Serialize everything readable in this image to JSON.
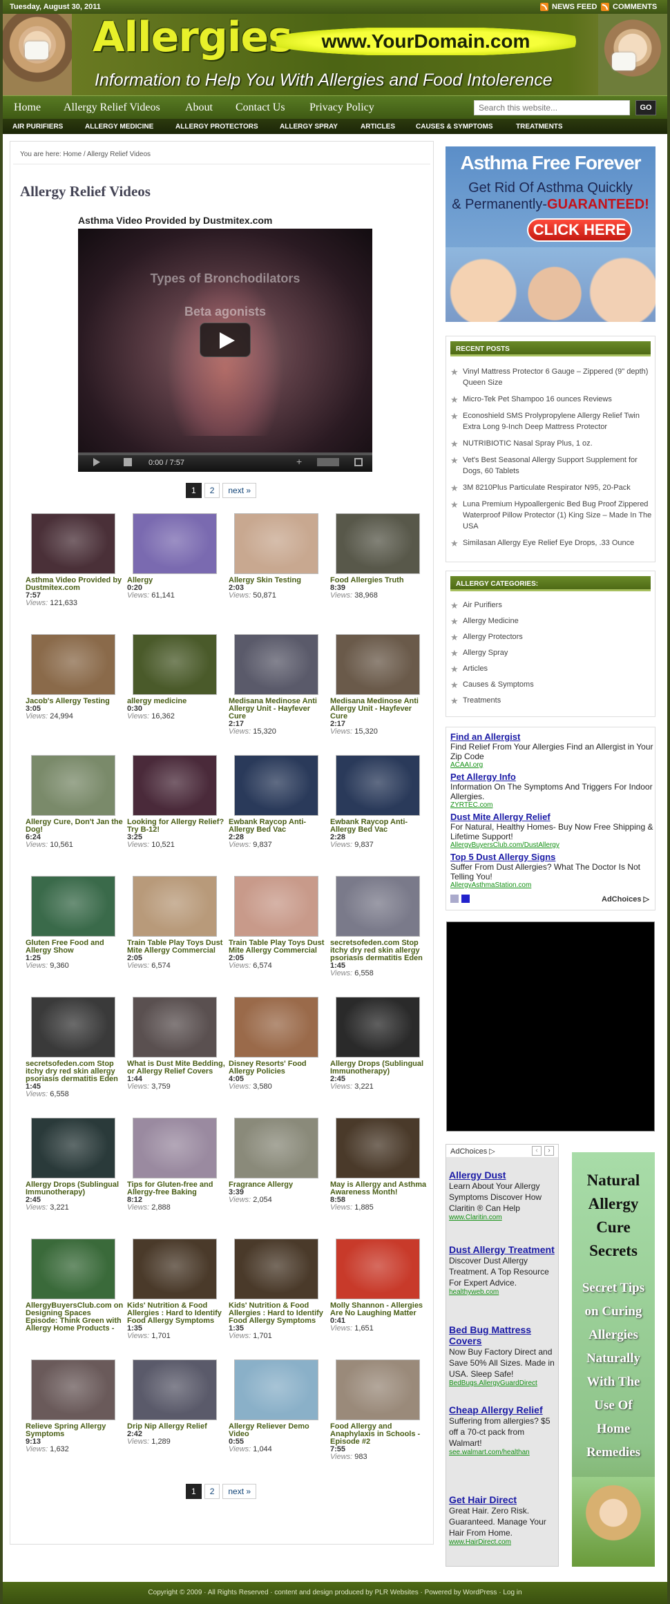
{
  "topbar": {
    "date": "Tuesday, August 30, 2011",
    "news_feed": "NEWS FEED",
    "comments": "COMMENTS"
  },
  "header": {
    "logo": "Allergies",
    "domain": "www.YourDomain.com",
    "tagline": "Information to Help You With Allergies and Food Intolerence"
  },
  "nav": {
    "items": [
      "Home",
      "Allergy Relief Videos",
      "About",
      "Contact Us",
      "Privacy Policy"
    ],
    "search_placeholder": "Search this website...",
    "go": "GO"
  },
  "subnav": {
    "items": [
      "AIR PURIFIERS",
      "ALLERGY MEDICINE",
      "ALLERGY PROTECTORS",
      "ALLERGY SPRAY",
      "ARTICLES",
      "CAUSES & SYMPTOMS",
      "TREATMENTS"
    ]
  },
  "main": {
    "breadcrumb": "You are here: Home / Allergy Relief Videos",
    "title": "Allergy Relief Videos",
    "video_title": "Asthma Video Provided by Dustmitex.com",
    "player": {
      "overlay1": "Types of Bronchodilators",
      "overlay2": "Beta agonists",
      "time": "0:00 / 7:57",
      "progress": 0
    },
    "pager": {
      "p1": "1",
      "p2": "2",
      "next": "next »"
    },
    "views_label": "Views:",
    "videos": [
      {
        "title": "Asthma Video Provided by Dustmitex.com",
        "duration": "7:57",
        "views": "121,633",
        "thumb": "#4a3038"
      },
      {
        "title": "Allergy",
        "duration": "0:20",
        "views": "61,141",
        "thumb": "#7a6ab0"
      },
      {
        "title": "Allergy Skin Testing",
        "duration": "2:03",
        "views": "50,871",
        "thumb": "#c8a890"
      },
      {
        "title": "Food Allergies Truth",
        "duration": "8:39",
        "views": "38,968",
        "thumb": "#58584a"
      },
      {
        "title": "Jacob's Allergy Testing",
        "duration": "3:05",
        "views": "24,994",
        "thumb": "#8a6a4a"
      },
      {
        "title": "allergy medicine",
        "duration": "0:30",
        "views": "16,362",
        "thumb": "#4a5a2a"
      },
      {
        "title": "Medisana Medinose Anti Allergy Unit - Hayfever Cure",
        "duration": "2:17",
        "views": "15,320",
        "thumb": "#5a5a6a"
      },
      {
        "title": "Medisana Medinose Anti Allergy Unit - Hayfever Cure",
        "duration": "2:17",
        "views": "15,320",
        "thumb": "#6a5a4a"
      },
      {
        "title": "Allergy Cure, Don't Jan the Dog!",
        "duration": "6:24",
        "views": "10,561",
        "thumb": "#7a8a6a"
      },
      {
        "title": "Looking for Allergy Relief? Try B-12!",
        "duration": "3:25",
        "views": "10,521",
        "thumb": "#4a2a3a"
      },
      {
        "title": "Ewbank Raycop Anti-Allergy Bed Vac",
        "duration": "2:28",
        "views": "9,837",
        "thumb": "#2a3a5a"
      },
      {
        "title": "Ewbank Raycop Anti-Allergy Bed Vac",
        "duration": "2:28",
        "views": "9,837",
        "thumb": "#2a3a5a"
      },
      {
        "title": "Gluten Free Food and Allergy Show",
        "duration": "1:25",
        "views": "9,360",
        "thumb": "#3a6a4a"
      },
      {
        "title": "Train Table Play Toys Dust Mite Allergy Commercial",
        "duration": "2:05",
        "views": "6,574",
        "thumb": "#b89a7a"
      },
      {
        "title": "Train Table Play Toys Dust Mite Allergy Commercial",
        "duration": "2:05",
        "views": "6,574",
        "thumb": "#c89a8a"
      },
      {
        "title": "secretsofeden.com Stop itchy dry red skin allergy psoriasis dermatitis Eden",
        "duration": "1:45",
        "views": "6,558",
        "thumb": "#7a7a8a"
      },
      {
        "title": "secretsofeden.com Stop itchy dry red skin allergy psoriasis dermatitis Eden",
        "duration": "1:45",
        "views": "6,558",
        "thumb": "#3a3a3a"
      },
      {
        "title": "What is Dust Mite Bedding, or Allergy Relief Covers",
        "duration": "1:44",
        "views": "3,759",
        "thumb": "#5a5050"
      },
      {
        "title": "Disney Resorts' Food Allergy Policies",
        "duration": "4:05",
        "views": "3,580",
        "thumb": "#9a6a4a"
      },
      {
        "title": "Allergy Drops (Sublingual Immunotherapy)",
        "duration": "2:45",
        "views": "3,221",
        "thumb": "#2a2a2a"
      },
      {
        "title": "Allergy Drops (Sublingual Immunotherapy)",
        "duration": "2:45",
        "views": "3,221",
        "thumb": "#2a3a3a"
      },
      {
        "title": "Tips for Gluten-free and Allergy-free Baking",
        "duration": "8:12",
        "views": "2,888",
        "thumb": "#9a8aa0"
      },
      {
        "title": "Fragrance Allergy",
        "duration": "3:39",
        "views": "2,054",
        "thumb": "#8a8a7a"
      },
      {
        "title": "May is Allergy and Asthma Awareness Month!",
        "duration": "8:58",
        "views": "1,885",
        "thumb": "#4a3a2a"
      },
      {
        "title": "AllergyBuyersClub.com on Designing Spaces Episode: Think Green with Allergy Home Products - Vacuums, Steam Cleaners, Air Purifiers",
        "duration": "",
        "views": "",
        "thumb": "#3a6a3a"
      },
      {
        "title": "Kids' Nutrition & Food Allergies : Hard to Identify Food Allergy Symptoms",
        "duration": "1:35",
        "views": "1,701",
        "thumb": "#4a3a2a"
      },
      {
        "title": "Kids' Nutrition & Food Allergies : Hard to Identify Food Allergy Symptoms",
        "duration": "1:35",
        "views": "1,701",
        "thumb": "#4a3a2a"
      },
      {
        "title": "Molly Shannon - Allergies Are No Laughing Matter",
        "duration": "0:41",
        "views": "1,651",
        "thumb": "#c83a2a"
      },
      {
        "title": "Relieve Spring Allergy Symptoms",
        "duration": "9:13",
        "views": "1,632",
        "thumb": "#6a5a5a"
      },
      {
        "title": "Drip Nip Allergy Relief",
        "duration": "2:42",
        "views": "1,289",
        "thumb": "#5a5a6a"
      },
      {
        "title": "Allergy Reliever Demo Video",
        "duration": "0:55",
        "views": "1,044",
        "thumb": "#8ab0c8"
      },
      {
        "title": "Food Allergy and Anaphylaxis in Schools - Episode #2",
        "duration": "7:55",
        "views": "983",
        "thumb": "#9a8a7a"
      }
    ]
  },
  "sidebar": {
    "asthma_ad": {
      "line1": "Asthma Free Forever",
      "line2a": "Get Rid Of Asthma Quickly",
      "line2b": "& Permanently-",
      "line2c": "GUARANTEED!",
      "cta": "CLICK HERE"
    },
    "recent_posts": {
      "title": "RECENT POSTS",
      "items": [
        "Vinyl Mattress Protector 6 Gauge – Zippered (9\" depth) Queen Size",
        "Micro-Tek Pet Shampoo 16 ounces Reviews",
        "Econoshield SMS Prolypropylene Allergy Relief Twin Extra Long 9-Inch Deep Mattress Protector",
        "NUTRIBIOTIC Nasal Spray Plus, 1 oz.",
        "Vet's Best Seasonal Allergy Support Supplement for Dogs, 60 Tablets",
        "3M 8210Plus Particulate Respirator N95, 20-Pack",
        "Luna Premium Hypoallergenic Bed Bug Proof Zippered Waterproof Pillow Protector (1) King Size – Made In The USA",
        "Similasan Allergy Eye Relief Eye Drops, .33 Ounce"
      ]
    },
    "categories": {
      "title": "ALLERGY CATEGORIES:",
      "items": [
        "Air Purifiers",
        "Allergy Medicine",
        "Allergy Protectors",
        "Allergy Spray",
        "Articles",
        "Causes & Symptoms",
        "Treatments"
      ]
    },
    "text_ads": [
      {
        "title": "Find an Allergist",
        "desc": "Find Relief From Your Allergies Find an Allergist in Your Zip Code",
        "url": "ACAAI.org"
      },
      {
        "title": "Pet Allergy Info",
        "desc": "Information On The Symptoms And Triggers For Indoor Allergies.",
        "url": "ZYRTEC.com"
      },
      {
        "title": "Dust Mite Allergy Relief",
        "desc": "For Natural, Healthy Homes- Buy Now Free Shipping & Lifetime Support!",
        "url": "AllergyBuyersClub.com/DustAllergy"
      },
      {
        "title": "Top 5 Dust Allergy Signs",
        "desc": "Suffer From Dust Allergies? What The Doctor Is Not Telling You!",
        "url": "AllergyAsthmaStation.com"
      }
    ],
    "adchoices": "AdChoices",
    "narrow_ads": [
      {
        "title": "Allergy Dust",
        "desc": "Learn About Your Allergy Symptoms Discover How Claritin ® Can Help",
        "url": "www.Claritin.com"
      },
      {
        "title": "Dust Allergy Treatment",
        "desc": "Discover Dust Allergy Treatment. A Top Resource For Expert Advice.",
        "url": "healthyweb.com"
      },
      {
        "title": "Bed Bug Mattress Covers",
        "desc": "Now Buy Factory Direct and Save 50% All Sizes. Made in USA. Sleep Safe!",
        "url": "BedBugs.AllergyGuardDirect"
      },
      {
        "title": "Cheap Allergy Relief",
        "desc": "Suffering from allergies? $5 off a 70-ct pack from Walmart!",
        "url": "see.walmart.com/healthan"
      },
      {
        "title": "Get Hair Direct",
        "desc": "Great Hair. Zero Risk. Guaranteed. Manage Your Hair From Home.",
        "url": "www.HairDirect.com"
      }
    ],
    "cure_ad": {
      "lines1": [
        "Natural",
        "Allergy",
        "Cure",
        "Secrets"
      ],
      "lines2": [
        "Secret Tips",
        "on Curing",
        "Allergies",
        "Naturally",
        "With The",
        "Use Of",
        "Home",
        "Remedies"
      ]
    }
  },
  "footer": {
    "text": "Copyright © 2009 · All Rights Reserved · content and design produced by PLR Websites · Powered by WordPress · Log in"
  }
}
